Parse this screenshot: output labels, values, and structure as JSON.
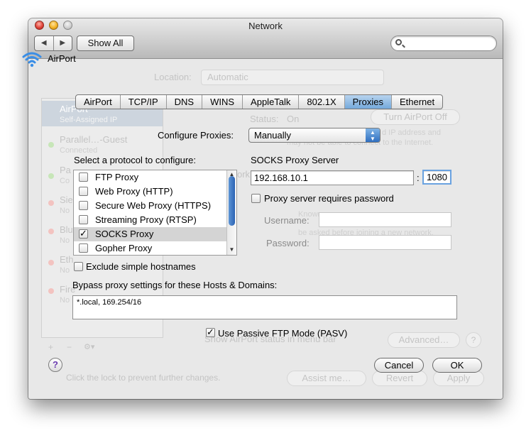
{
  "window": {
    "title": "Network",
    "show_all": "Show All",
    "back_icon": "◀",
    "forward_icon": "▶",
    "search_placeholder": ""
  },
  "background": {
    "location_label": "Location:",
    "location_value": "Automatic",
    "interface_name": "AirPort",
    "services": [
      {
        "name": "AirPort",
        "status": "Self-Assigned IP"
      },
      {
        "name": "Parallel…-Guest",
        "status": "Connected"
      },
      {
        "name": "Pa",
        "status": "Co"
      },
      {
        "name": "Sie",
        "status": "No"
      },
      {
        "name": "Blu",
        "status": "No"
      },
      {
        "name": "Eth",
        "status": "No"
      },
      {
        "name": "Fire",
        "status": "No"
      }
    ],
    "status_label": "Status:",
    "status_value": "On",
    "turn_off": "Turn AirPort Off",
    "status_desc_1": "d IP address and",
    "status_desc_2": "may not be able to connect to the Internet.",
    "known_1": "Known",
    "known_2": "be asked before joining a new network.",
    "net_label": "ork",
    "show_airport": "Show AirPort status in menu bar",
    "advanced": "Advanced…",
    "lock_text": "Click the lock to prevent further changes.",
    "assist": "Assist me…",
    "revert": "Revert",
    "apply": "Apply",
    "list_add": "+",
    "list_remove": "−",
    "list_action": "⚙▾",
    "help_bg": "?"
  },
  "tabs": [
    "AirPort",
    "TCP/IP",
    "DNS",
    "WINS",
    "AppleTalk",
    "802.1X",
    "Proxies",
    "Ethernet"
  ],
  "active_tab": "Proxies",
  "sheet": {
    "configure_label": "Configure Proxies:",
    "configure_value": "Manually",
    "protocol_label": "Select a protocol to configure:",
    "protocols": [
      {
        "label": "FTP Proxy",
        "checked": false,
        "mark": ""
      },
      {
        "label": "Web Proxy (HTTP)",
        "checked": false,
        "mark": ""
      },
      {
        "label": "Secure Web Proxy (HTTPS)",
        "checked": false,
        "mark": ""
      },
      {
        "label": "Streaming Proxy (RTSP)",
        "checked": false,
        "mark": ""
      },
      {
        "label": "SOCKS Proxy",
        "checked": true,
        "mark": "✓"
      },
      {
        "label": "Gopher Proxy",
        "checked": false,
        "mark": ""
      }
    ],
    "server_label": "SOCKS Proxy Server",
    "server_host": "192.168.10.1",
    "server_colon": ":",
    "server_port": "1080",
    "requires_password": "Proxy server requires password",
    "username_label": "Username:",
    "password_label": "Password:",
    "username_value": "",
    "password_value": "",
    "exclude_simple": "Exclude simple hostnames",
    "bypass_label": "Bypass proxy settings for these Hosts & Domains:",
    "bypass_value": "*.local, 169.254/16",
    "passive_ftp": "Use Passive FTP Mode (PASV)",
    "passive_mark": "✓",
    "cancel": "Cancel",
    "ok": "OK",
    "help": "?"
  },
  "colors": {
    "accent": "#74a9dc",
    "selection": "#d4d4d4",
    "scroll_thumb": "#2c63b4",
    "focus_ring": "#6aa2e0"
  }
}
